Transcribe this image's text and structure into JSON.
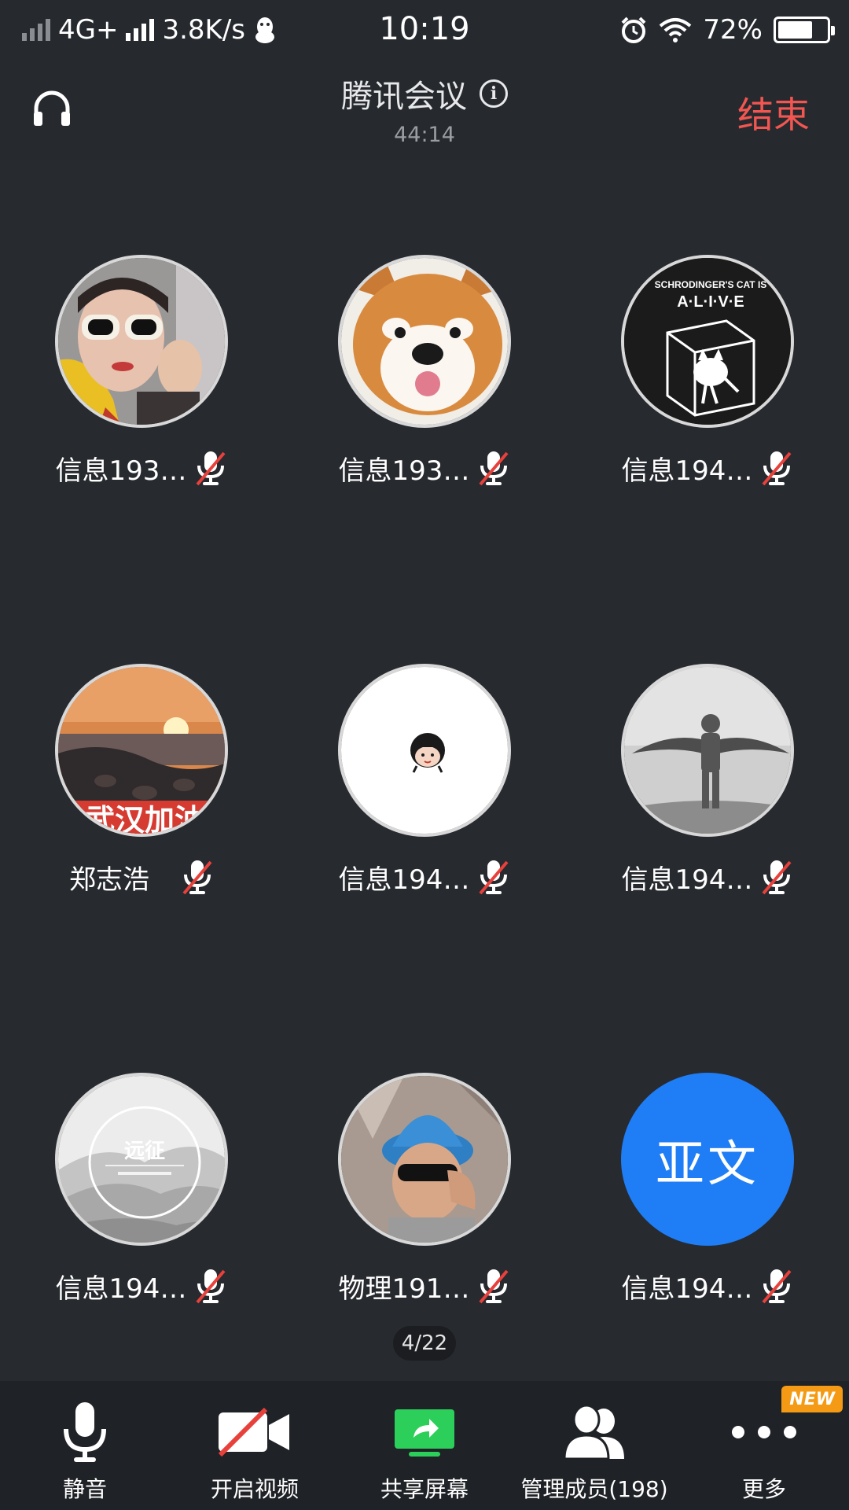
{
  "status_bar": {
    "network": "4G+",
    "speed": "3.8K/s",
    "time": "10:19",
    "battery_percent": "72%",
    "battery_level": 0.72,
    "icons": [
      "signal-icon",
      "qq-penguin-icon",
      "alarm-icon",
      "wifi-icon",
      "battery-icon"
    ]
  },
  "header": {
    "title": "腾讯会议",
    "duration": "44:14",
    "end_label": "结束",
    "end_color": "#f15651",
    "icons": [
      "headphones-icon",
      "info-icon"
    ]
  },
  "participants": [
    {
      "name": "信息193…",
      "muted": true,
      "avatar": "photo-girl-sunglasses"
    },
    {
      "name": "信息193…",
      "muted": true,
      "avatar": "photo-shiba-dog"
    },
    {
      "name": "信息194…",
      "muted": true,
      "avatar": "schrodingers-cat-logo",
      "avatar_text_1": "SCHRODINGER'S CAT IS",
      "avatar_text_2": "A·L·I·V·E"
    },
    {
      "name": "郑志浩",
      "muted": true,
      "avatar": "photo-sunset-beach",
      "avatar_text_1": "武汉加油"
    },
    {
      "name": "信息194…",
      "muted": true,
      "avatar": "cartoon-girl"
    },
    {
      "name": "信息194…",
      "muted": true,
      "avatar": "photo-man-wings"
    },
    {
      "name": "信息194…",
      "muted": true,
      "avatar": "mountains-logo",
      "avatar_text_1": "远征"
    },
    {
      "name": "物理191…",
      "muted": true,
      "avatar": "photo-person-blue-hat"
    },
    {
      "name": "信息194…",
      "muted": true,
      "avatar": "initials",
      "avatar_text_1": "亚文",
      "avatar_color": "#1f7df5"
    }
  ],
  "pagination": "4/22",
  "toolbar": {
    "mute_label": "静音",
    "video_label": "开启视频",
    "share_label": "共享屏幕",
    "members_label": "管理成员(198)",
    "more_label": "更多",
    "new_badge": "NEW",
    "share_color": "#2bcf5a",
    "badge_color": "#f59a14"
  }
}
